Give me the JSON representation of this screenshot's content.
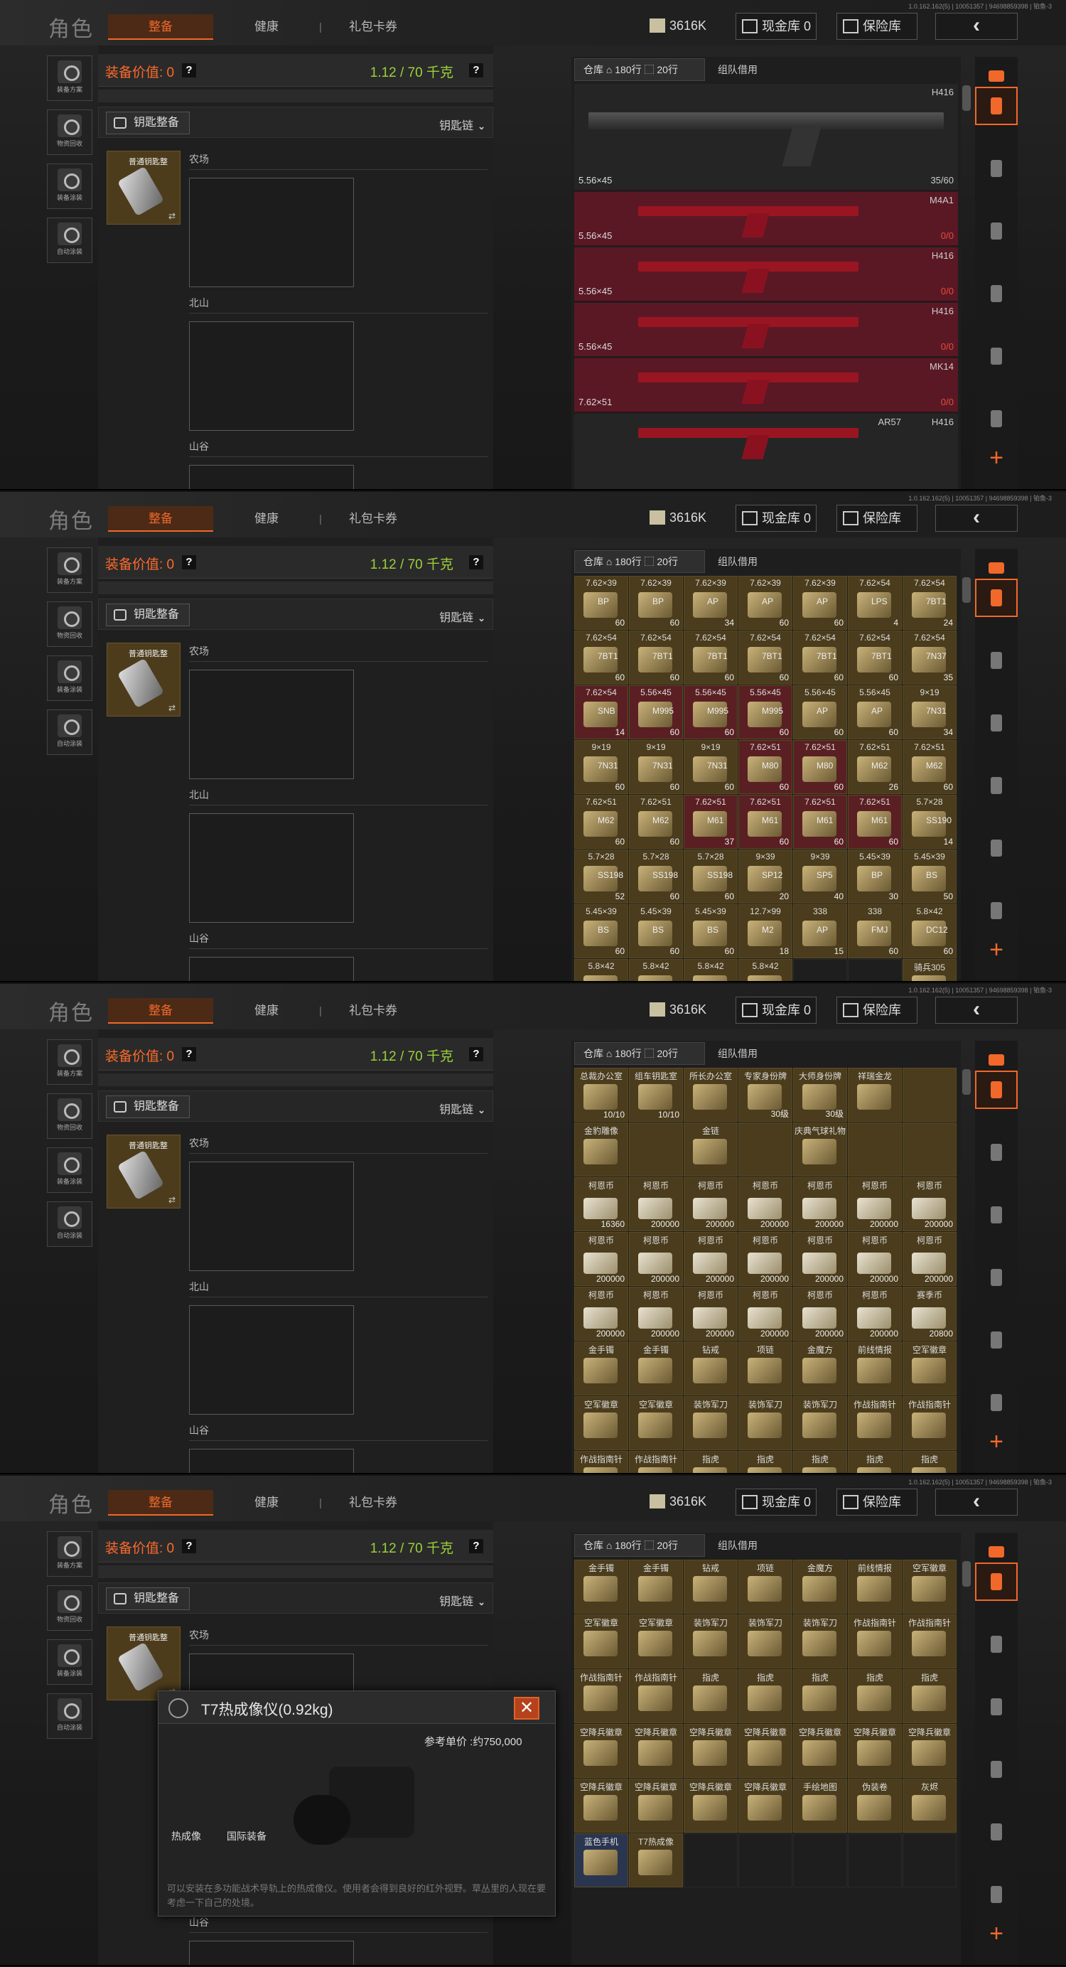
{
  "version": "1.0.162.162(5) | 10051357 | 94698859398 | 铂鱼-3",
  "header": {
    "title": "角色",
    "tabs": [
      "整备",
      "健康",
      "礼包卡券"
    ],
    "balance": "3616K",
    "cash_btn": "现金库 0",
    "safe_btn": "保险库",
    "back_btn": "‹"
  },
  "sidebar": [
    "装备方案",
    "物资回收",
    "装备涂装",
    "自动涂装"
  ],
  "equip": {
    "value_label": "装备价值: 0",
    "weight": "1.12 / 70 千克",
    "q": "?",
    "key_btn": "钥匙整备",
    "keychain": "钥匙链",
    "key_item": "普通钥匙整",
    "swap": "⇄",
    "maps": [
      "农场",
      "北山",
      "山谷"
    ]
  },
  "warehouse": {
    "label": "仓库 ⌂ 180行 ⬚ 20行",
    "team": "组队借用",
    "plus": "+"
  },
  "panel1": [
    {
      "name": "H416",
      "cal": "5.56×45",
      "count": "35/60",
      "first": true
    },
    {
      "name": "M4A1",
      "cal": "5.56×45",
      "count": "0/0"
    },
    {
      "name": "H416",
      "cal": "5.56×45",
      "count": "0/0"
    },
    {
      "name": "H416",
      "cal": "5.56×45",
      "count": "0/0"
    },
    {
      "name": "MK14",
      "cal": "7.62×51",
      "count": "0/0"
    },
    {
      "name": "AR57",
      "name2": "H416",
      "cal": "",
      "count": ""
    }
  ],
  "panel2": [
    [
      [
        "7.62×39",
        "BP",
        "60"
      ],
      [
        "7.62×39",
        "BP",
        "60"
      ],
      [
        "7.62×39",
        "AP",
        "34"
      ],
      [
        "7.62×39",
        "AP",
        "60"
      ],
      [
        "7.62×39",
        "AP",
        "60"
      ],
      [
        "7.62×54",
        "LPS",
        "4"
      ],
      [
        "7.62×54",
        "7BT1",
        "24"
      ]
    ],
    [
      [
        "7.62×54",
        "7BT1",
        "60"
      ],
      [
        "7.62×54",
        "7BT1",
        "60"
      ],
      [
        "7.62×54",
        "7BT1",
        "60"
      ],
      [
        "7.62×54",
        "7BT1",
        "60"
      ],
      [
        "7.62×54",
        "7BT1",
        "60"
      ],
      [
        "7.62×54",
        "7BT1",
        "60"
      ],
      [
        "7.62×54",
        "7N37",
        "35"
      ]
    ],
    [
      [
        "7.62×54",
        "SNB",
        "14"
      ],
      [
        "5.56×45",
        "M995",
        "60"
      ],
      [
        "5.56×45",
        "M995",
        "60"
      ],
      [
        "5.56×45",
        "M995",
        "60"
      ],
      [
        "5.56×45",
        "AP",
        "60"
      ],
      [
        "5.56×45",
        "AP",
        "60"
      ],
      [
        "9×19",
        "7N31",
        "34"
      ]
    ],
    [
      [
        "9×19",
        "7N31",
        "60"
      ],
      [
        "9×19",
        "7N31",
        "60"
      ],
      [
        "9×19",
        "7N31",
        "60"
      ],
      [
        "7.62×51",
        "M80",
        "60"
      ],
      [
        "7.62×51",
        "M80",
        "60"
      ],
      [
        "7.62×51",
        "M62",
        "26"
      ],
      [
        "7.62×51",
        "M62",
        "60"
      ]
    ],
    [
      [
        "7.62×51",
        "M62",
        "60"
      ],
      [
        "7.62×51",
        "M62",
        "60"
      ],
      [
        "7.62×51",
        "M61",
        "37"
      ],
      [
        "7.62×51",
        "M61",
        "60"
      ],
      [
        "7.62×51",
        "M61",
        "60"
      ],
      [
        "7.62×51",
        "M61",
        "60"
      ],
      [
        "5.7×28",
        "SS190",
        "14"
      ]
    ],
    [
      [
        "5.7×28",
        "SS198",
        "52"
      ],
      [
        "5.7×28",
        "SS198",
        "60"
      ],
      [
        "5.7×28",
        "SS198",
        "60"
      ],
      [
        "9×39",
        "SP12",
        "20"
      ],
      [
        "9×39",
        "SP5",
        "40"
      ],
      [
        "5.45×39",
        "BP",
        "30"
      ],
      [
        "5.45×39",
        "BS",
        "50"
      ]
    ],
    [
      [
        "5.45×39",
        "BS",
        "60"
      ],
      [
        "5.45×39",
        "BS",
        "60"
      ],
      [
        "5.45×39",
        "BS",
        "60"
      ],
      [
        "12.7×99",
        "M2",
        "18"
      ],
      [
        "338",
        "AP",
        "15"
      ],
      [
        "338",
        "FMJ",
        "60"
      ],
      [
        "5.8×42",
        "DC12",
        "60"
      ]
    ],
    [
      [
        "5.8×42",
        "",
        ""
      ],
      [
        "5.8×42",
        "",
        ""
      ],
      [
        "5.8×42",
        "",
        ""
      ],
      [
        "5.8×42",
        "",
        ""
      ],
      [
        "",
        "",
        ""
      ],
      [
        "",
        "",
        ""
      ],
      [
        "骑兵305",
        "",
        ""
      ]
    ]
  ],
  "panel3": [
    [
      [
        "总裁办公室",
        "10/10"
      ],
      [
        "组车钥匙室",
        "10/10"
      ],
      [
        "所长办公室",
        ""
      ],
      [
        "专家身份牌",
        "30级"
      ],
      [
        "大师身份牌",
        "30级"
      ],
      [
        "祥瑞金龙",
        ""
      ],
      [
        "",
        ""
      ]
    ],
    [
      [
        "金豹雕像",
        ""
      ],
      [
        "",
        ""
      ],
      [
        "金链",
        ""
      ],
      [
        "",
        ""
      ],
      [
        "庆典气球礼物",
        ""
      ],
      [
        "",
        ""
      ],
      [
        "",
        ""
      ]
    ],
    [
      [
        "柯恩币",
        "16360"
      ],
      [
        "柯恩币",
        "200000"
      ],
      [
        "柯恩币",
        "200000"
      ],
      [
        "柯恩币",
        "200000"
      ],
      [
        "柯恩币",
        "200000"
      ],
      [
        "柯恩币",
        "200000"
      ],
      [
        "柯恩币",
        "200000"
      ]
    ],
    [
      [
        "柯恩币",
        "200000"
      ],
      [
        "柯恩币",
        "200000"
      ],
      [
        "柯恩币",
        "200000"
      ],
      [
        "柯恩币",
        "200000"
      ],
      [
        "柯恩币",
        "200000"
      ],
      [
        "柯恩币",
        "200000"
      ],
      [
        "柯恩币",
        "200000"
      ]
    ],
    [
      [
        "柯恩币",
        "200000"
      ],
      [
        "柯恩币",
        "200000"
      ],
      [
        "柯恩币",
        "200000"
      ],
      [
        "柯恩币",
        "200000"
      ],
      [
        "柯恩币",
        "200000"
      ],
      [
        "柯恩币",
        "200000"
      ],
      [
        "赛季币",
        "20800"
      ]
    ],
    [
      [
        "金手镯",
        ""
      ],
      [
        "金手镯",
        ""
      ],
      [
        "钻戒",
        ""
      ],
      [
        "项链",
        ""
      ],
      [
        "金魔方",
        ""
      ],
      [
        "前线情报",
        ""
      ],
      [
        "空军徽章",
        ""
      ]
    ],
    [
      [
        "空军徽章",
        ""
      ],
      [
        "空军徽章",
        ""
      ],
      [
        "装饰军刀",
        ""
      ],
      [
        "装饰军刀",
        ""
      ],
      [
        "装饰军刀",
        ""
      ],
      [
        "作战指南针",
        ""
      ],
      [
        "作战指南针",
        ""
      ]
    ],
    [
      [
        "作战指南针",
        ""
      ],
      [
        "作战指南针",
        ""
      ],
      [
        "指虎",
        ""
      ],
      [
        "指虎",
        ""
      ],
      [
        "指虎",
        ""
      ],
      [
        "指虎",
        ""
      ],
      [
        "指虎",
        ""
      ]
    ]
  ],
  "panel4": [
    [
      [
        "金手镯",
        ""
      ],
      [
        "金手镯",
        ""
      ],
      [
        "钻戒",
        ""
      ],
      [
        "项链",
        ""
      ],
      [
        "金魔方",
        ""
      ],
      [
        "前线情报",
        ""
      ],
      [
        "空军徽章",
        ""
      ]
    ],
    [
      [
        "空军徽章",
        ""
      ],
      [
        "空军徽章",
        ""
      ],
      [
        "装饰军刀",
        ""
      ],
      [
        "装饰军刀",
        ""
      ],
      [
        "装饰军刀",
        ""
      ],
      [
        "作战指南针",
        ""
      ],
      [
        "作战指南针",
        ""
      ]
    ],
    [
      [
        "作战指南针",
        ""
      ],
      [
        "作战指南针",
        ""
      ],
      [
        "指虎",
        ""
      ],
      [
        "指虎",
        ""
      ],
      [
        "指虎",
        ""
      ],
      [
        "指虎",
        ""
      ],
      [
        "指虎",
        ""
      ]
    ],
    [
      [
        "空降兵徽章",
        ""
      ],
      [
        "空降兵徽章",
        ""
      ],
      [
        "空降兵徽章",
        ""
      ],
      [
        "空降兵徽章",
        ""
      ],
      [
        "空降兵徽章",
        ""
      ],
      [
        "空降兵徽章",
        ""
      ],
      [
        "空降兵徽章",
        ""
      ]
    ],
    [
      [
        "空降兵徽章",
        ""
      ],
      [
        "空降兵徽章",
        ""
      ],
      [
        "空降兵徽章",
        ""
      ],
      [
        "空降兵徽章",
        ""
      ],
      [
        "手绘地图",
        ""
      ],
      [
        "伪装卷",
        ""
      ],
      [
        "灰烬",
        ""
      ]
    ],
    [
      [
        "蓝色手机",
        ""
      ],
      [
        "T7热成像",
        ""
      ],
      [
        "",
        ""
      ],
      [
        "",
        ""
      ],
      [
        "",
        ""
      ],
      [
        "",
        ""
      ],
      [
        "",
        ""
      ]
    ]
  ],
  "tooltip": {
    "name": "T7热成像仪(0.92kg)",
    "close": "✕",
    "price": "参考单价 :约750,000",
    "tag1": "热成像",
    "tag2": "国际装备",
    "desc": "可以安装在多功能战术导轨上的热成像仪。使用者会得到良好的红外视野。草丛里的人现在要考虑一下自己的处境。"
  }
}
